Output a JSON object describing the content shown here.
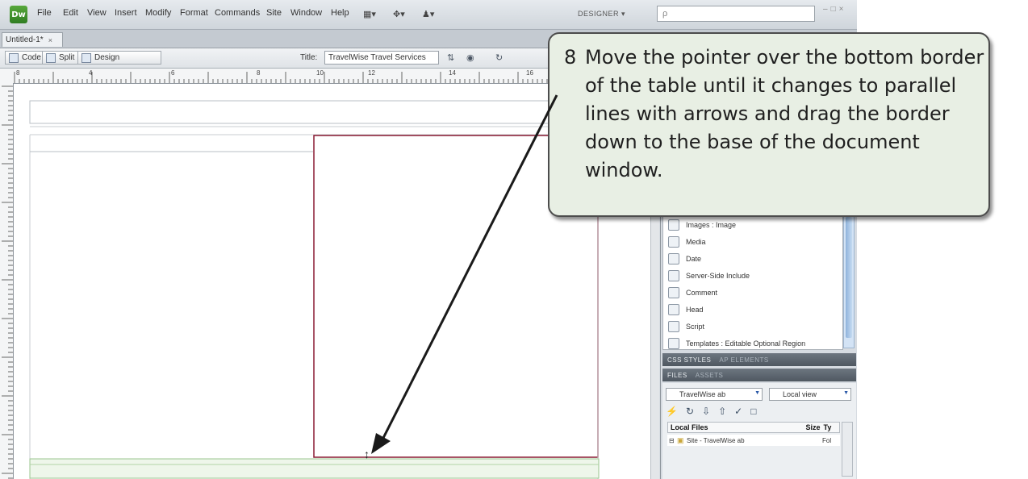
{
  "menubar": {
    "logo": "Dw",
    "items": [
      "File",
      "Edit",
      "View",
      "Insert",
      "Modify",
      "Format",
      "Commands",
      "Site",
      "Window",
      "Help"
    ],
    "workspace": "DESIGNER",
    "search_placeholder": "ρ"
  },
  "document": {
    "tab_label": "Untitled-1*",
    "tab_close": "×",
    "view_buttons": [
      "Code",
      "Split",
      "Design"
    ],
    "title_label": "Title:",
    "title_value": "TravelWise Travel Services"
  },
  "ruler": {
    "labels": [
      "8",
      "4",
      "6",
      "8",
      "10",
      "12",
      "14",
      "16"
    ]
  },
  "insert_panel": {
    "items": [
      "Images : Image",
      "Media",
      "Date",
      "Server-Side Include",
      "Comment",
      "Head",
      "Script",
      "Templates : Editable Optional Region"
    ]
  },
  "panels": {
    "css_styles": "CSS STYLES",
    "css_sub": "AP ELEMENTS",
    "files": "FILES",
    "files_sub": "ASSETS",
    "site_name": "TravelWise ab",
    "view_mode": "Local view",
    "col_local": "Local Files",
    "col_size": "Size",
    "col_type": "Ty",
    "row_site": "Site - TravelWise ab",
    "row_type": "Fol"
  },
  "callout": {
    "number": "8",
    "text": "Move the pointer over the bottom border of the table until it changes to parallel lines with arrows and drag the border down to the base of the document window."
  },
  "cursor_glyph": "↕"
}
